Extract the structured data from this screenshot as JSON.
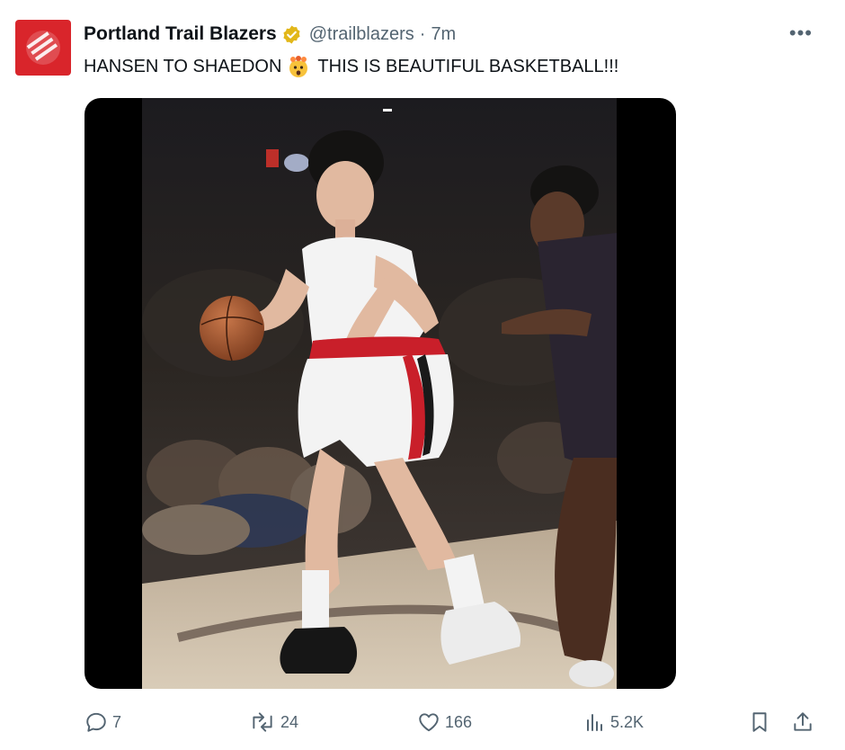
{
  "account": {
    "display_name": "Portland Trail Blazers",
    "handle": "@trailblazers",
    "separator": "·",
    "time": "7m",
    "avatar_icon": "trail-blazers-logo",
    "verified_icon": "verified-gold-badge-icon"
  },
  "tweet": {
    "text_before": "HANSEN TO SHAEDON",
    "emoji": "exploding-head-emoji",
    "text_after": "THIS IS BEAUTIFUL BASKETBALL!!!"
  },
  "media": {
    "type": "video",
    "subject": "basketball-game-frame"
  },
  "actions": {
    "replies": "7",
    "reposts": "24",
    "likes": "166",
    "views": "5.2K"
  },
  "colors": {
    "brand_red": "#d9252b",
    "verified_gold": "#e2b719",
    "text_primary": "#0f1419",
    "text_secondary": "#536471"
  }
}
